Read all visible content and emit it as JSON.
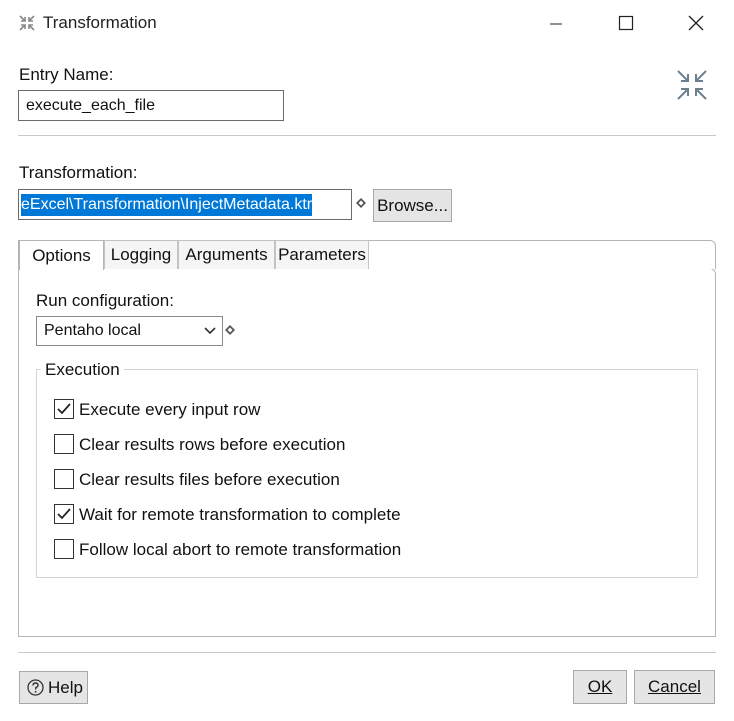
{
  "window": {
    "title": "Transformation",
    "icon": "transformation-icon",
    "controls": [
      "minimize-icon",
      "maximize-icon",
      "close-icon"
    ]
  },
  "entry": {
    "label": "Entry Name:",
    "value": "execute_each_file"
  },
  "transformation": {
    "label": "Transformation:",
    "path": "eExcel\\Transformation\\InjectMetadata.ktr",
    "browse_label": "Browse..."
  },
  "tabs": [
    {
      "label": "Options",
      "active": true
    },
    {
      "label": "Logging",
      "active": false
    },
    {
      "label": "Arguments",
      "active": false
    },
    {
      "label": "Parameters",
      "active": false
    }
  ],
  "options": {
    "run_config_label": "Run configuration:",
    "run_config_value": "Pentaho local",
    "execution_label": "Execution",
    "checks": [
      {
        "label": "Execute every input row",
        "checked": true
      },
      {
        "label": "Clear results rows before execution",
        "checked": false
      },
      {
        "label": "Clear results files before execution",
        "checked": false
      },
      {
        "label": "Wait for remote transformation to complete",
        "checked": true
      },
      {
        "label": "Follow local abort to remote transformation",
        "checked": false
      }
    ]
  },
  "footer": {
    "help_label": "Help",
    "ok_label": "OK",
    "cancel_label": "Cancel"
  },
  "colors": {
    "selection": "#0078d7",
    "button_bg": "#e5e5e5"
  }
}
